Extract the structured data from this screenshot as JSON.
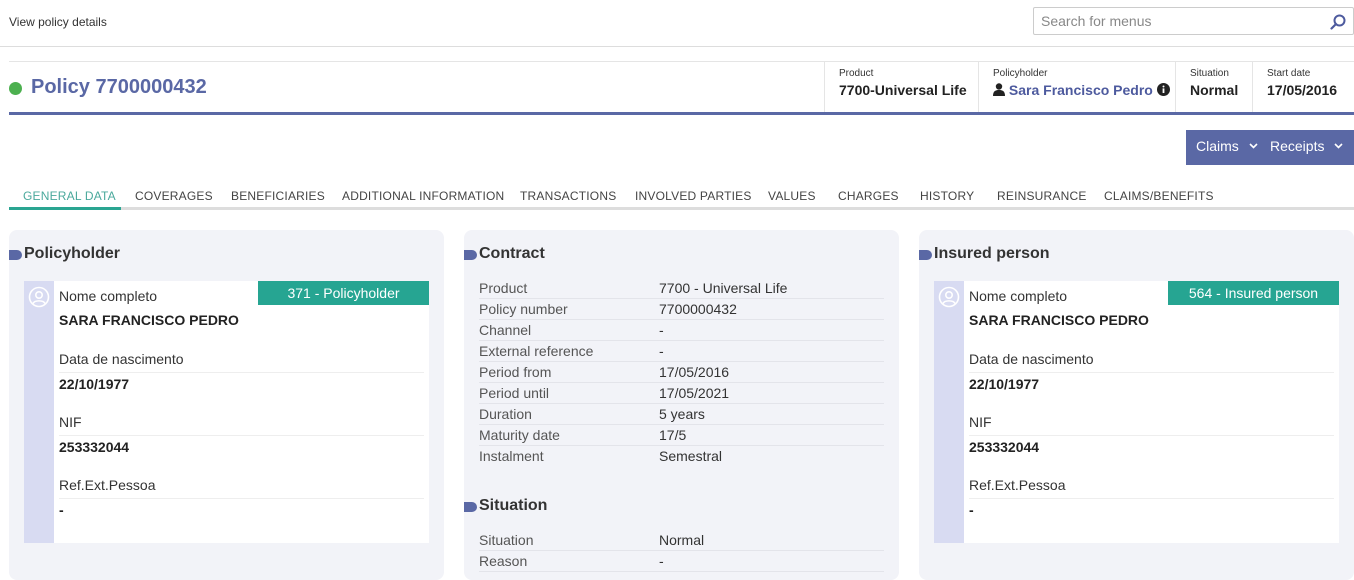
{
  "breadcrumb": "View policy details",
  "search": {
    "placeholder": "Search for menus"
  },
  "policy": {
    "title": "Policy 7700000432",
    "status_color": "#4cb04f",
    "product_label": "Product",
    "product_value": "7700-Universal Life",
    "policyholder_label": "Policyholder",
    "policyholder_value": "Sara Francisco Pedro",
    "situation_label": "Situation",
    "situation_value": "Normal",
    "start_label": "Start date",
    "start_value": "17/05/2016"
  },
  "actions": {
    "claims": "Claims",
    "receipts": "Receipts"
  },
  "tabs": [
    "GENERAL DATA",
    "COVERAGES",
    "BENEFICIARIES",
    "ADDITIONAL INFORMATION",
    "TRANSACTIONS",
    "INVOLVED PARTIES",
    "VALUES",
    "CHARGES",
    "HISTORY",
    "REINSURANCE",
    "CLAIMS/BENEFITS"
  ],
  "policyholder_panel": {
    "title": "Policyholder",
    "badge": "371 - Policyholder",
    "fields": [
      {
        "label": "Nome completo",
        "value": "SARA FRANCISCO PEDRO"
      },
      {
        "label": "Data de nascimento",
        "value": "22/10/1977"
      },
      {
        "label": "NIF",
        "value": "253332044"
      },
      {
        "label": "Ref.Ext.Pessoa",
        "value": "-"
      }
    ]
  },
  "contract_panel": {
    "title": "Contract",
    "rows": [
      {
        "k": "Product",
        "v": "7700 - Universal Life"
      },
      {
        "k": "Policy number",
        "v": "7700000432"
      },
      {
        "k": "Channel",
        "v": "-"
      },
      {
        "k": "External reference",
        "v": "-"
      },
      {
        "k": "Period from",
        "v": "17/05/2016"
      },
      {
        "k": "Period until",
        "v": "17/05/2021"
      },
      {
        "k": "Duration",
        "v": "5 years"
      },
      {
        "k": "Maturity date",
        "v": "17/5"
      },
      {
        "k": "Instalment",
        "v": "Semestral"
      }
    ],
    "situation_title": "Situation",
    "situation_rows": [
      {
        "k": "Situation",
        "v": "Normal"
      },
      {
        "k": "Reason",
        "v": "-"
      }
    ]
  },
  "insured_panel": {
    "title": "Insured person",
    "badge": "564 - Insured person",
    "fields": [
      {
        "label": "Nome completo",
        "value": "SARA FRANCISCO PEDRO"
      },
      {
        "label": "Data de nascimento",
        "value": "22/10/1977"
      },
      {
        "label": "NIF",
        "value": "253332044"
      },
      {
        "label": "Ref.Ext.Pessoa",
        "value": "-"
      }
    ]
  }
}
